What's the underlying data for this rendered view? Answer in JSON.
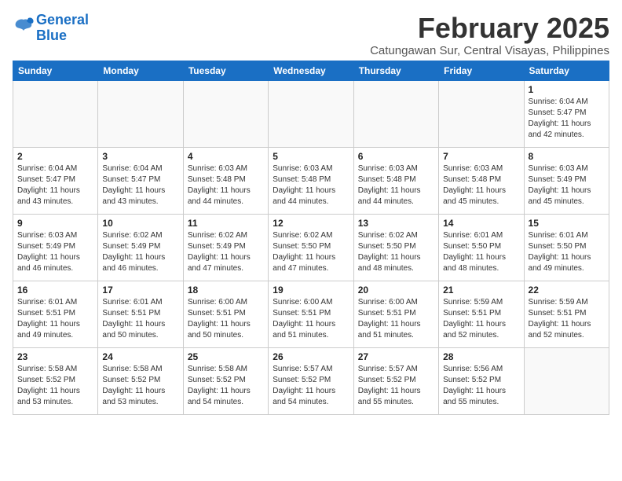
{
  "logo": {
    "line1": "General",
    "line2": "Blue"
  },
  "title": "February 2025",
  "subtitle": "Catungawan Sur, Central Visayas, Philippines",
  "days_of_week": [
    "Sunday",
    "Monday",
    "Tuesday",
    "Wednesday",
    "Thursday",
    "Friday",
    "Saturday"
  ],
  "weeks": [
    [
      {
        "day": "",
        "info": ""
      },
      {
        "day": "",
        "info": ""
      },
      {
        "day": "",
        "info": ""
      },
      {
        "day": "",
        "info": ""
      },
      {
        "day": "",
        "info": ""
      },
      {
        "day": "",
        "info": ""
      },
      {
        "day": "1",
        "info": "Sunrise: 6:04 AM\nSunset: 5:47 PM\nDaylight: 11 hours and 42 minutes."
      }
    ],
    [
      {
        "day": "2",
        "info": "Sunrise: 6:04 AM\nSunset: 5:47 PM\nDaylight: 11 hours and 43 minutes."
      },
      {
        "day": "3",
        "info": "Sunrise: 6:04 AM\nSunset: 5:47 PM\nDaylight: 11 hours and 43 minutes."
      },
      {
        "day": "4",
        "info": "Sunrise: 6:03 AM\nSunset: 5:48 PM\nDaylight: 11 hours and 44 minutes."
      },
      {
        "day": "5",
        "info": "Sunrise: 6:03 AM\nSunset: 5:48 PM\nDaylight: 11 hours and 44 minutes."
      },
      {
        "day": "6",
        "info": "Sunrise: 6:03 AM\nSunset: 5:48 PM\nDaylight: 11 hours and 44 minutes."
      },
      {
        "day": "7",
        "info": "Sunrise: 6:03 AM\nSunset: 5:48 PM\nDaylight: 11 hours and 45 minutes."
      },
      {
        "day": "8",
        "info": "Sunrise: 6:03 AM\nSunset: 5:49 PM\nDaylight: 11 hours and 45 minutes."
      }
    ],
    [
      {
        "day": "9",
        "info": "Sunrise: 6:03 AM\nSunset: 5:49 PM\nDaylight: 11 hours and 46 minutes."
      },
      {
        "day": "10",
        "info": "Sunrise: 6:02 AM\nSunset: 5:49 PM\nDaylight: 11 hours and 46 minutes."
      },
      {
        "day": "11",
        "info": "Sunrise: 6:02 AM\nSunset: 5:49 PM\nDaylight: 11 hours and 47 minutes."
      },
      {
        "day": "12",
        "info": "Sunrise: 6:02 AM\nSunset: 5:50 PM\nDaylight: 11 hours and 47 minutes."
      },
      {
        "day": "13",
        "info": "Sunrise: 6:02 AM\nSunset: 5:50 PM\nDaylight: 11 hours and 48 minutes."
      },
      {
        "day": "14",
        "info": "Sunrise: 6:01 AM\nSunset: 5:50 PM\nDaylight: 11 hours and 48 minutes."
      },
      {
        "day": "15",
        "info": "Sunrise: 6:01 AM\nSunset: 5:50 PM\nDaylight: 11 hours and 49 minutes."
      }
    ],
    [
      {
        "day": "16",
        "info": "Sunrise: 6:01 AM\nSunset: 5:51 PM\nDaylight: 11 hours and 49 minutes."
      },
      {
        "day": "17",
        "info": "Sunrise: 6:01 AM\nSunset: 5:51 PM\nDaylight: 11 hours and 50 minutes."
      },
      {
        "day": "18",
        "info": "Sunrise: 6:00 AM\nSunset: 5:51 PM\nDaylight: 11 hours and 50 minutes."
      },
      {
        "day": "19",
        "info": "Sunrise: 6:00 AM\nSunset: 5:51 PM\nDaylight: 11 hours and 51 minutes."
      },
      {
        "day": "20",
        "info": "Sunrise: 6:00 AM\nSunset: 5:51 PM\nDaylight: 11 hours and 51 minutes."
      },
      {
        "day": "21",
        "info": "Sunrise: 5:59 AM\nSunset: 5:51 PM\nDaylight: 11 hours and 52 minutes."
      },
      {
        "day": "22",
        "info": "Sunrise: 5:59 AM\nSunset: 5:51 PM\nDaylight: 11 hours and 52 minutes."
      }
    ],
    [
      {
        "day": "23",
        "info": "Sunrise: 5:58 AM\nSunset: 5:52 PM\nDaylight: 11 hours and 53 minutes."
      },
      {
        "day": "24",
        "info": "Sunrise: 5:58 AM\nSunset: 5:52 PM\nDaylight: 11 hours and 53 minutes."
      },
      {
        "day": "25",
        "info": "Sunrise: 5:58 AM\nSunset: 5:52 PM\nDaylight: 11 hours and 54 minutes."
      },
      {
        "day": "26",
        "info": "Sunrise: 5:57 AM\nSunset: 5:52 PM\nDaylight: 11 hours and 54 minutes."
      },
      {
        "day": "27",
        "info": "Sunrise: 5:57 AM\nSunset: 5:52 PM\nDaylight: 11 hours and 55 minutes."
      },
      {
        "day": "28",
        "info": "Sunrise: 5:56 AM\nSunset: 5:52 PM\nDaylight: 11 hours and 55 minutes."
      },
      {
        "day": "",
        "info": ""
      }
    ]
  ]
}
